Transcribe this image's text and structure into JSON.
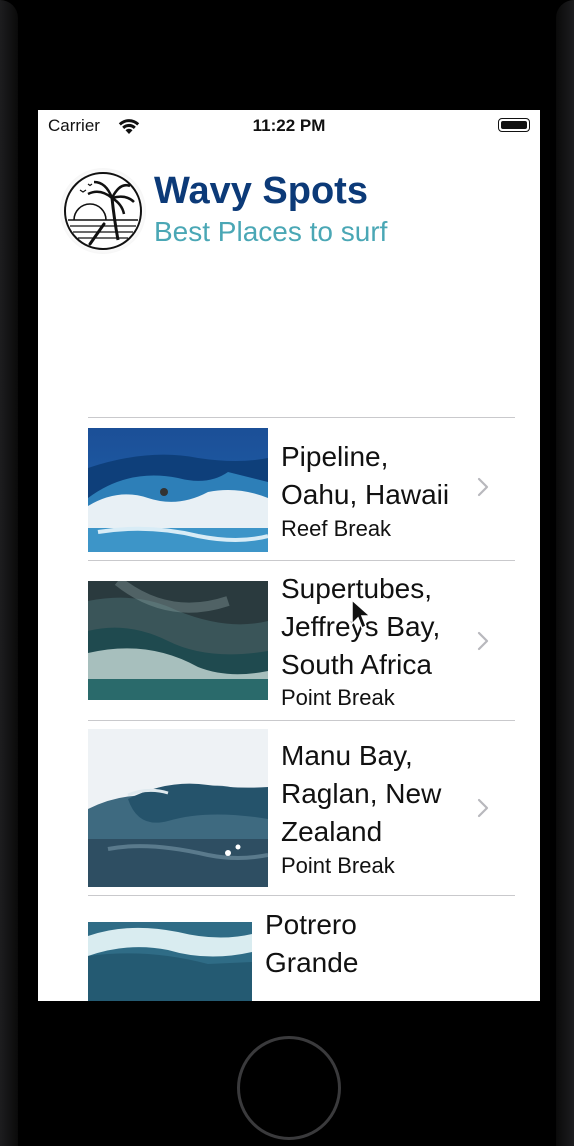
{
  "status_bar": {
    "carrier": "Carrier",
    "time": "11:22 PM"
  },
  "header": {
    "title": "Wavy Spots",
    "subtitle": "Best Places to surf",
    "logo_icon": "palm-beach-logo-icon"
  },
  "spots": [
    {
      "title_lines": [
        "Pipeline,",
        "Oahu, Hawaii"
      ],
      "type": "Reef Break"
    },
    {
      "title_lines": [
        "Supertubes,",
        "Jeffreys Bay,",
        "South Africa"
      ],
      "type": "Point Break"
    },
    {
      "title_lines": [
        "Manu Bay,",
        "Raglan, New",
        "Zealand"
      ],
      "type": "Point Break"
    },
    {
      "title_lines": [
        "Potrero",
        "Grande"
      ],
      "type": ""
    }
  ],
  "colors": {
    "title": "#0c3a78",
    "subtitle": "#4aa7b5",
    "separator": "#c9c9cc",
    "chevron": "#b8b8bd"
  }
}
